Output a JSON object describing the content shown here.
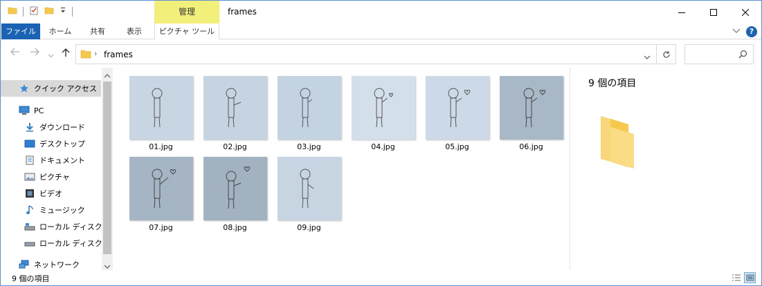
{
  "window": {
    "title": "frames",
    "context_tab": "管理"
  },
  "ribbon": {
    "tabs": [
      {
        "label": "ファイル"
      },
      {
        "label": "ホーム"
      },
      {
        "label": "共有"
      },
      {
        "label": "表示"
      },
      {
        "label": "ピクチャ ツール"
      }
    ]
  },
  "address": {
    "path": "frames"
  },
  "nav": {
    "items": [
      {
        "label": "クイック アクセス",
        "icon": "star-icon"
      },
      {
        "label": "PC",
        "icon": "pc-icon"
      },
      {
        "label": "ダウンロード",
        "icon": "download-icon"
      },
      {
        "label": "デスクトップ",
        "icon": "desktop-icon"
      },
      {
        "label": "ドキュメント",
        "icon": "document-icon"
      },
      {
        "label": "ピクチャ",
        "icon": "pictures-icon"
      },
      {
        "label": "ビデオ",
        "icon": "video-icon"
      },
      {
        "label": "ミュージック",
        "icon": "music-icon"
      },
      {
        "label": "ローカル ディスク (C:",
        "icon": "drive-icon"
      },
      {
        "label": "ローカル ディスク (D:",
        "icon": "drive-icon"
      },
      {
        "label": "ネットワーク",
        "icon": "network-icon"
      }
    ]
  },
  "files": [
    {
      "name": "01.jpg"
    },
    {
      "name": "02.jpg"
    },
    {
      "name": "03.jpg"
    },
    {
      "name": "04.jpg"
    },
    {
      "name": "05.jpg"
    },
    {
      "name": "06.jpg"
    },
    {
      "name": "07.jpg"
    },
    {
      "name": "08.jpg"
    },
    {
      "name": "09.jpg"
    }
  ],
  "details": {
    "count": "9 個の項目"
  },
  "status": {
    "text": "9 個の項目"
  },
  "colors": {
    "accent": "#1a62b3",
    "context_tab": "#f2f07a",
    "folder": "#f5c94c"
  }
}
